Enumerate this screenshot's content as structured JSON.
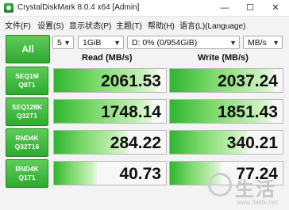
{
  "window": {
    "title": "CrystalDiskMark 8.0.4 x64 [Admin]",
    "minimize": "—",
    "maximize": "☐",
    "close": "✕"
  },
  "menu": [
    "文件(F)",
    "设置(S)",
    "显示状态(P)",
    "主题(T)",
    "帮助(H)",
    "语言(L)(Language)"
  ],
  "controls": {
    "all_button": "All",
    "count": "5",
    "size": "1GiB",
    "drive": "D: 0% (0/954GiB)",
    "unit": "MB/s"
  },
  "headers": {
    "read": "Read (MB/s)",
    "write": "Write (MB/s)"
  },
  "rows": [
    {
      "line1": "SEQ1M",
      "line2": "Q8T1",
      "read": "2061.53",
      "write": "2037.24",
      "read_fill": 0.92,
      "write_fill": 0.92
    },
    {
      "line1": "SEQ128K",
      "line2": "Q32T1",
      "read": "1748.14",
      "write": "1851.43",
      "read_fill": 0.88,
      "write_fill": 0.9
    },
    {
      "line1": "RND4K",
      "line2": "Q32T16",
      "read": "284.22",
      "write": "340.21",
      "read_fill": 0.66,
      "write_fill": 0.68
    },
    {
      "line1": "RND4K",
      "line2": "Q1T1",
      "read": "40.73",
      "write": "77.24",
      "read_fill": 0.38,
      "write_fill": 0.46
    }
  ],
  "watermark": {
    "big": "生活",
    "small": "www.3elife.net"
  },
  "colors": {
    "accent_green": "#2fa92f",
    "bar_green": "#2fb52f"
  }
}
